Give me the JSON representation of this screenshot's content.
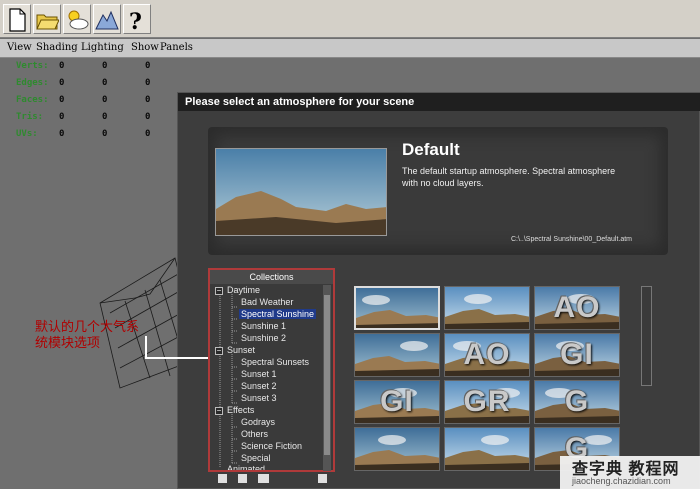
{
  "toolbar": {
    "icons": [
      "new-file-icon",
      "open-folder-icon",
      "atmosphere-icon",
      "terrain-icon",
      "help-icon"
    ]
  },
  "menu": {
    "items": [
      "View",
      "Shading",
      "Lighting",
      "Show",
      "Panels"
    ]
  },
  "stats": [
    {
      "label": "Verts:",
      "values": [
        "0",
        "0",
        "0"
      ]
    },
    {
      "label": "Edges:",
      "values": [
        "0",
        "0",
        "0"
      ]
    },
    {
      "label": "Faces:",
      "values": [
        "0",
        "0",
        "0"
      ]
    },
    {
      "label": "Tris:",
      "values": [
        "0",
        "0",
        "0"
      ]
    },
    {
      "label": "UVs:",
      "values": [
        "0",
        "0",
        "0"
      ]
    }
  ],
  "dialog": {
    "title": "Please select an atmosphere for your scene",
    "atmosphere_name": "Default",
    "atmosphere_description": "The default startup atmosphere. Spectral atmosphere with no cloud layers.",
    "atmosphere_path": "C:\\..\\Spectral Sunshine\\00_Default.atm"
  },
  "collections": {
    "header": "Collections",
    "items": [
      {
        "label": "Daytime",
        "type": "group"
      },
      {
        "label": "Bad Weather",
        "type": "child"
      },
      {
        "label": "Spectral Sunshine",
        "type": "child",
        "selected": true
      },
      {
        "label": "Sunshine 1",
        "type": "child"
      },
      {
        "label": "Sunshine 2",
        "type": "child"
      },
      {
        "label": "Sunset",
        "type": "group"
      },
      {
        "label": "Spectral Sunsets",
        "type": "child"
      },
      {
        "label": "Sunset 1",
        "type": "child"
      },
      {
        "label": "Sunset 2",
        "type": "child"
      },
      {
        "label": "Sunset 3",
        "type": "child"
      },
      {
        "label": "Effects",
        "type": "group"
      },
      {
        "label": "Godrays",
        "type": "child"
      },
      {
        "label": "Others",
        "type": "child"
      },
      {
        "label": "Science Fiction",
        "type": "child"
      },
      {
        "label": "Special",
        "type": "child"
      },
      {
        "label": "Animated",
        "type": "group"
      }
    ]
  },
  "thumbnails": [
    {
      "label": "",
      "selected": true
    },
    {
      "label": ""
    },
    {
      "label": "AO"
    },
    {
      "label": ""
    },
    {
      "label": "AO"
    },
    {
      "label": "GI"
    },
    {
      "label": "GI"
    },
    {
      "label": "GR"
    },
    {
      "label": "G"
    },
    {
      "label": ""
    },
    {
      "label": ""
    },
    {
      "label": "G"
    }
  ],
  "annotation": {
    "line1": "默认的几个大气系",
    "line2": "统模块选项"
  },
  "watermark": {
    "title": "查字典 教程网",
    "url": "jiaocheng.chazidian.com"
  }
}
